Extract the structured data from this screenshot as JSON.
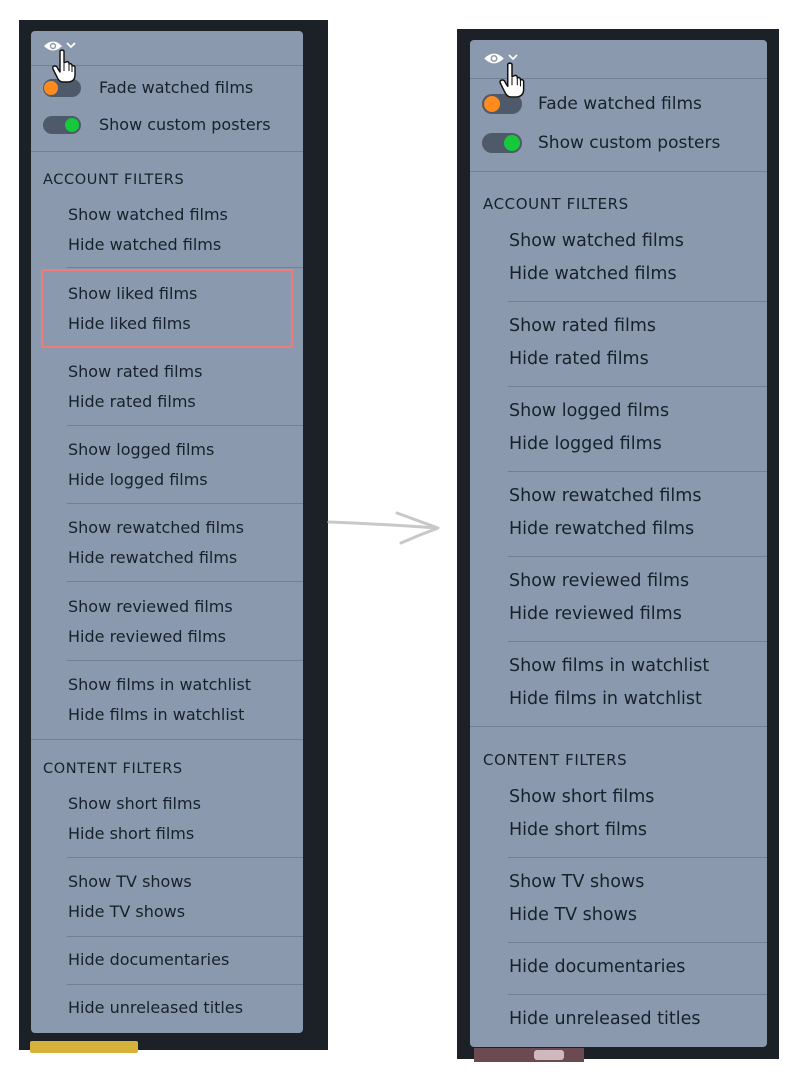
{
  "before_panel": {
    "fade_watched_label": "Fade watched films",
    "custom_posters_label": "Show custom posters",
    "account_filters_heading": "ACCOUNT FILTERS",
    "content_filters_heading": "CONTENT FILTERS",
    "account_items": [
      "Show watched films",
      "Hide watched films",
      "Show liked films",
      "Hide liked films",
      "Show rated films",
      "Hide rated films",
      "Show logged films",
      "Hide logged films",
      "Show rewatched films",
      "Hide rewatched films",
      "Show reviewed films",
      "Hide reviewed films",
      "Show films in watchlist",
      "Hide films in watchlist"
    ],
    "content_items": [
      "Show short films",
      "Hide short films",
      "Show TV shows",
      "Hide TV shows",
      "Hide documentaries",
      "Hide unreleased titles"
    ]
  },
  "after_panel": {
    "fade_watched_label": "Fade watched films",
    "custom_posters_label": "Show custom posters",
    "account_filters_heading": "ACCOUNT FILTERS",
    "content_filters_heading": "CONTENT FILTERS",
    "account_items": [
      "Show watched films",
      "Hide watched films",
      "Show rated films",
      "Hide rated films",
      "Show logged films",
      "Hide logged films",
      "Show rewatched films",
      "Hide rewatched films",
      "Show reviewed films",
      "Hide reviewed films",
      "Show films in watchlist",
      "Hide films in watchlist"
    ],
    "content_items": [
      "Show short films",
      "Hide short films",
      "Show TV shows",
      "Hide TV shows",
      "Hide documentaries",
      "Hide unreleased titles"
    ]
  },
  "colors": {
    "panel_bg": "#8a99ad",
    "frame_bg": "#1c2128",
    "toggle_off_knob": "#ff8a1e",
    "toggle_on_knob": "#15c93b",
    "highlight_border": "#f07a7e"
  },
  "icons": [
    "eye-icon",
    "chevron-down-icon",
    "hand-cursor-icon",
    "arrow-right-icon"
  ]
}
